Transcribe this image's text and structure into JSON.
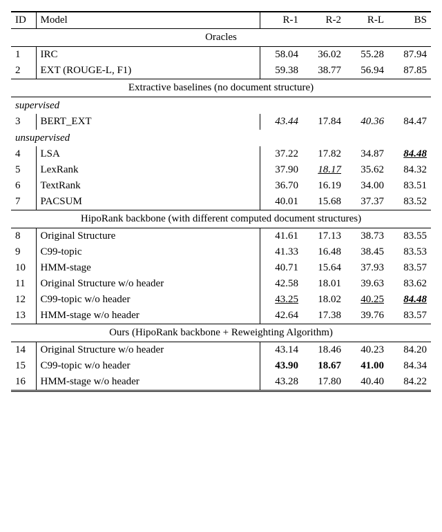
{
  "headers": {
    "id": "ID",
    "model": "Model",
    "r1": "R-1",
    "r2": "R-2",
    "rl": "R-L",
    "bs": "BS"
  },
  "sections": {
    "oracles": "Oracles",
    "extractive": "Extractive baselines (no document structure)",
    "hiporank": "HipoRank backbone (with different computed document structures)",
    "ours": "Ours (HipoRank backbone + Reweighting Algorithm)"
  },
  "subgroups": {
    "supervised": "supervised",
    "unsupervised": "unsupervised"
  },
  "rows": {
    "r1": {
      "id": "1",
      "model": "IRC",
      "v": [
        "58.04",
        "36.02",
        "55.28",
        "87.94"
      ]
    },
    "r2": {
      "id": "2",
      "model": "EXT (ROUGE-L, F1)",
      "v": [
        "59.38",
        "38.77",
        "56.94",
        "87.85"
      ]
    },
    "r3": {
      "id": "3",
      "model": "BERT_EXT",
      "v": [
        "43.44",
        "17.84",
        "40.36",
        "84.47"
      ]
    },
    "r4": {
      "id": "4",
      "model": "LSA",
      "v": [
        "37.22",
        "17.82",
        "34.87",
        "84.48"
      ]
    },
    "r5": {
      "id": "5",
      "model": "LexRank",
      "v": [
        "37.90",
        "18.17",
        "35.62",
        "84.32"
      ]
    },
    "r6": {
      "id": "6",
      "model": "TextRank",
      "v": [
        "36.70",
        "16.19",
        "34.00",
        "83.51"
      ]
    },
    "r7": {
      "id": "7",
      "model": "PACSUM",
      "v": [
        "40.01",
        "15.68",
        "37.37",
        "83.52"
      ]
    },
    "r8": {
      "id": "8",
      "model": "Original Structure",
      "v": [
        "41.61",
        "17.13",
        "38.73",
        "83.55"
      ]
    },
    "r9": {
      "id": "9",
      "model": "C99-topic",
      "v": [
        "41.33",
        "16.48",
        "38.45",
        "83.53"
      ]
    },
    "r10": {
      "id": "10",
      "model": "HMM-stage",
      "v": [
        "40.71",
        "15.64",
        "37.93",
        "83.57"
      ]
    },
    "r11": {
      "id": "11",
      "model": "Original Structure w/o header",
      "v": [
        "42.58",
        "18.01",
        "39.63",
        "83.62"
      ]
    },
    "r12": {
      "id": "12",
      "model": "C99-topic w/o header",
      "v": [
        "43.25",
        "18.02",
        "40.25",
        "84.48"
      ]
    },
    "r13": {
      "id": "13",
      "model": "HMM-stage w/o header",
      "v": [
        "42.64",
        "17.38",
        "39.76",
        "83.57"
      ]
    },
    "r14": {
      "id": "14",
      "model": "Original Structure w/o header",
      "v": [
        "43.14",
        "18.46",
        "40.23",
        "84.20"
      ]
    },
    "r15": {
      "id": "15",
      "model": "C99-topic w/o header",
      "v": [
        "43.90",
        "18.67",
        "41.00",
        "84.34"
      ]
    },
    "r16": {
      "id": "16",
      "model": "HMM-stage w/o header",
      "v": [
        "43.28",
        "17.80",
        "40.40",
        "84.22"
      ]
    }
  },
  "chart_data": {
    "type": "table",
    "title": "",
    "columns": [
      "ID",
      "Model",
      "R-1",
      "R-2",
      "R-L",
      "BS"
    ],
    "groups": [
      {
        "name": "Oracles",
        "rows": [
          {
            "ID": 1,
            "Model": "IRC",
            "R-1": 58.04,
            "R-2": 36.02,
            "R-L": 55.28,
            "BS": 87.94
          },
          {
            "ID": 2,
            "Model": "EXT (ROUGE-L, F1)",
            "R-1": 59.38,
            "R-2": 38.77,
            "R-L": 56.94,
            "BS": 87.85
          }
        ]
      },
      {
        "name": "Extractive baselines (no document structure)",
        "subgroups": [
          {
            "name": "supervised",
            "rows": [
              {
                "ID": 3,
                "Model": "BERT_EXT",
                "R-1": 43.44,
                "R-2": 17.84,
                "R-L": 40.36,
                "BS": 84.47
              }
            ]
          },
          {
            "name": "unsupervised",
            "rows": [
              {
                "ID": 4,
                "Model": "LSA",
                "R-1": 37.22,
                "R-2": 17.82,
                "R-L": 34.87,
                "BS": 84.48
              },
              {
                "ID": 5,
                "Model": "LexRank",
                "R-1": 37.9,
                "R-2": 18.17,
                "R-L": 35.62,
                "BS": 84.32
              },
              {
                "ID": 6,
                "Model": "TextRank",
                "R-1": 36.7,
                "R-2": 16.19,
                "R-L": 34.0,
                "BS": 83.51
              },
              {
                "ID": 7,
                "Model": "PACSUM",
                "R-1": 40.01,
                "R-2": 15.68,
                "R-L": 37.37,
                "BS": 83.52
              }
            ]
          }
        ]
      },
      {
        "name": "HipoRank backbone (with different computed document structures)",
        "rows": [
          {
            "ID": 8,
            "Model": "Original Structure",
            "R-1": 41.61,
            "R-2": 17.13,
            "R-L": 38.73,
            "BS": 83.55
          },
          {
            "ID": 9,
            "Model": "C99-topic",
            "R-1": 41.33,
            "R-2": 16.48,
            "R-L": 38.45,
            "BS": 83.53
          },
          {
            "ID": 10,
            "Model": "HMM-stage",
            "R-1": 40.71,
            "R-2": 15.64,
            "R-L": 37.93,
            "BS": 83.57
          },
          {
            "ID": 11,
            "Model": "Original Structure w/o header",
            "R-1": 42.58,
            "R-2": 18.01,
            "R-L": 39.63,
            "BS": 83.62
          },
          {
            "ID": 12,
            "Model": "C99-topic w/o header",
            "R-1": 43.25,
            "R-2": 18.02,
            "R-L": 40.25,
            "BS": 84.48
          },
          {
            "ID": 13,
            "Model": "HMM-stage w/o header",
            "R-1": 42.64,
            "R-2": 17.38,
            "R-L": 39.76,
            "BS": 83.57
          }
        ]
      },
      {
        "name": "Ours (HipoRank backbone + Reweighting Algorithm)",
        "rows": [
          {
            "ID": 14,
            "Model": "Original Structure w/o header",
            "R-1": 43.14,
            "R-2": 18.46,
            "R-L": 40.23,
            "BS": 84.2
          },
          {
            "ID": 15,
            "Model": "C99-topic w/o header",
            "R-1": 43.9,
            "R-2": 18.67,
            "R-L": 41.0,
            "BS": 84.34
          },
          {
            "ID": 16,
            "Model": "HMM-stage w/o header",
            "R-1": 43.28,
            "R-2": 17.8,
            "R-L": 40.4,
            "BS": 84.22
          }
        ]
      }
    ]
  }
}
